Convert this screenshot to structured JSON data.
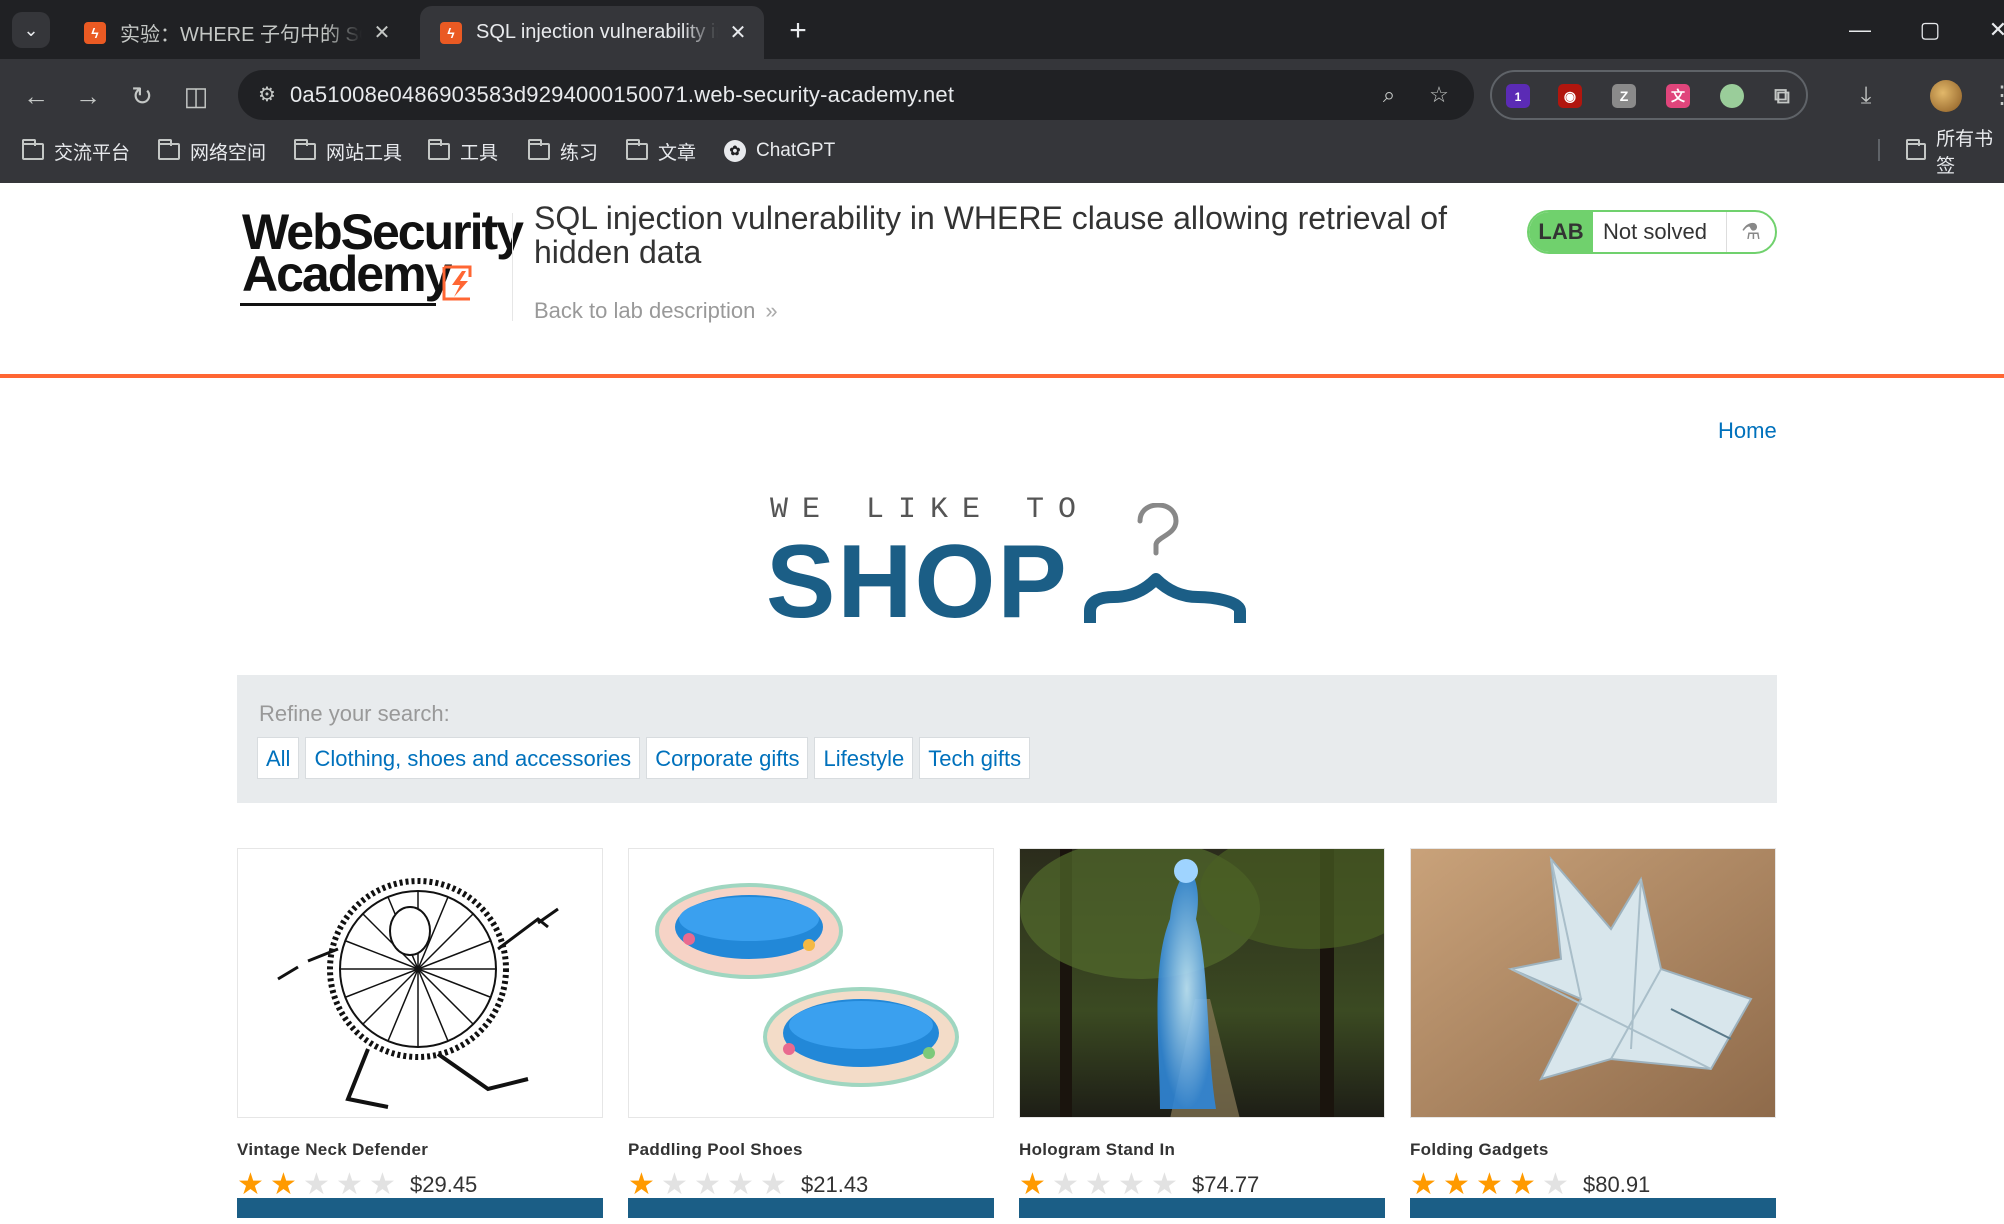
{
  "browser": {
    "tabs": [
      {
        "title": "实验：WHERE 子句中的 SQL 注入漏洞，允许检索隐藏数据",
        "close": "✕"
      },
      {
        "title": "SQL injection vulnerability in WHERE clause allowing retrieval of hidden data",
        "close": "✕"
      }
    ],
    "new_tab": "+",
    "url": "0a51008e0486903583d9294000150071.web-security-academy.net",
    "extension_badge": "1",
    "bookmarks": [
      "交流平台",
      "网络空间",
      "网站工具",
      "工具",
      "练习",
      "文章",
      "ChatGPT"
    ],
    "bookmarks_right": "所有书签"
  },
  "lab": {
    "logo_line1": "WebSecurity",
    "logo_line2": "Academy",
    "title": "SQL injection vulnerability in WHERE clause allowing retrieval of hidden data",
    "back_link": "Back to lab description",
    "badge": "LAB",
    "status": "Not solved"
  },
  "shop": {
    "home": "Home",
    "tagline": "WE LIKE TO",
    "brand": "SHOP",
    "refine_label": "Refine your search:",
    "categories": [
      "All",
      "Clothing, shoes and accessories",
      "Corporate gifts",
      "Lifestyle",
      "Tech gifts"
    ],
    "products": [
      {
        "name": "Vintage Neck Defender",
        "rating": 2,
        "price": "$29.45"
      },
      {
        "name": "Paddling Pool Shoes",
        "rating": 1,
        "price": "$21.43"
      },
      {
        "name": "Hologram Stand In",
        "rating": 1,
        "price": "$74.77"
      },
      {
        "name": "Folding Gadgets",
        "rating": 4,
        "price": "$80.91"
      }
    ]
  },
  "colors": {
    "accent_orange": "#ff6633",
    "link_blue": "#0071bc",
    "brand_blue": "#1b5e86",
    "lab_green": "#70d16d",
    "star": "#ff9a00"
  }
}
